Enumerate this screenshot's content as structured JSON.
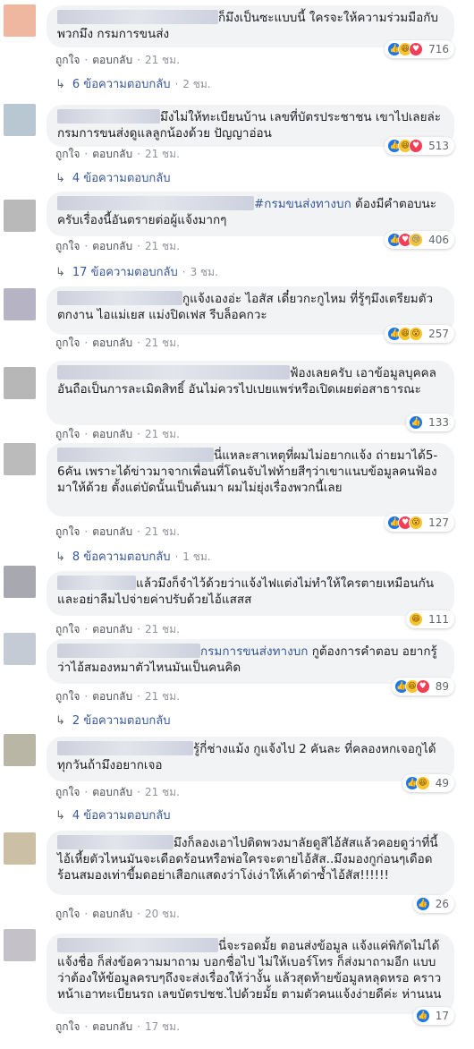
{
  "colors": {
    "bubble": "#f2f3f5",
    "link": "#385898",
    "meta": "#90949c",
    "like": "#1877f2",
    "love": "#f33e58",
    "haha": "#f7c32e"
  },
  "ui": {
    "like_label": "ถูกใจ",
    "reply_label": "ตอบกลับ",
    "separator": "·"
  },
  "comments": [
    {
      "name_hidden": true,
      "text": "ก็มึงเป็นซะแบบนี้ ใครจะให้ความร่วมมือกับพวกมึง กรมการขนส่ง",
      "reactions": [
        "like-icon",
        "haha-icon",
        "love-icon"
      ],
      "count": "716",
      "time": "21 ชม.",
      "replies": "6 ข้อความตอบกลับ",
      "replies_time": "2 ชม."
    },
    {
      "name_hidden": true,
      "text": "มึงไม่ให้ทะเบียนบ้าน เลขที่บัตรประชาชน เขาไปเลยล่ะ กรมการขนส่งดูแลลูกน้องด้วย ปัญญาอ่อน",
      "reactions": [
        "like-icon",
        "haha-icon",
        "love-icon"
      ],
      "count": "513",
      "time": "21 ชม.",
      "replies": "4 ข้อความตอบกลับ",
      "replies_time": ""
    },
    {
      "name_hidden": true,
      "tag": "#กรมขนส่งทางบก",
      "text": "ต้องมีคำตอบนะครับเรื่องนี้อันตรายต่อผู้แจ้งมากๆ",
      "reactions": [
        "like-icon",
        "love-icon",
        "sad-icon"
      ],
      "count": "406",
      "time": "21 ชม.",
      "replies": "17 ข้อความตอบกลับ",
      "replies_time": "3 ชม."
    },
    {
      "name_hidden": true,
      "text": "กูแจ้งเองอ่ะ ไอสัส เดี๋ยวกะกูไหม ที่รู้ๆมึงเตรียมตัวตกงาน ไอแม่เยส แม่งปิดเฟส รีบล็อคกวะ",
      "reactions": [
        "like-icon",
        "haha-icon",
        "wow-icon"
      ],
      "count": "257",
      "time": "21 ชม.",
      "replies": "",
      "replies_time": ""
    },
    {
      "name_hidden": true,
      "text": "ฟ้องเลยครับ เอาข้อมูลบุคคลอันถือเป็นการละเมิดสิทธิ์ อันไม่ควรไปเปยแพร่หรือเปิดเผยต่อสาธารณะ",
      "reactions": [
        "like-icon"
      ],
      "count": "133",
      "time": "21 ชม.",
      "replies": "",
      "replies_time": ""
    },
    {
      "name_hidden": true,
      "text": "นี่แหละสาเหตุที่ผมไม่อยากแจ้ง ถ่ายมาได้5-6คัน เพราะได้ข่าวมาจากเพื่อนที่โดนจับไฟท้ายสีๆว่าเขาแนบข้อมูลคนฟ้องมาให้ด้วย ตั้งแต่บัดนั้นเป็นต้นมา ผมไม่ยุ่งเรื่องพวกนี้เลย",
      "reactions": [
        "like-icon",
        "love-icon",
        "wow-icon"
      ],
      "count": "127",
      "time": "21 ชม.",
      "replies": "8 ข้อความตอบกลับ",
      "replies_time": "1 ชม."
    },
    {
      "name_hidden": true,
      "text": "แล้วมึงก็จำไว้ด้วยว่าแจ้งไฟแต่งไม่ทำให้ใครตายเหมือนกัน และอย่าลืมไปจ่ายค่าปรับด้วยไอ้แสสส",
      "reactions": [
        "haha-icon"
      ],
      "count": "111",
      "time": "21 ชม.",
      "replies": "",
      "replies_time": ""
    },
    {
      "name_hidden": true,
      "tag": "กรมการขนส่งทางบก",
      "text": "กูต้องการคำตอบ อยากรู้ว่าไอ้สมองหมาตัวไหนมันเป็นคนคิด",
      "reactions": [
        "like-icon",
        "haha-icon",
        "love-icon"
      ],
      "count": "89",
      "time": "21 ชม.",
      "replies": "2 ข้อความตอบกลับ",
      "replies_time": ""
    },
    {
      "name_hidden": true,
      "text": "รู้กี่ช่างแม้ง กูแจ้งไป 2 คันละ ที่คลองหกเจอกูได้ทุกวันถ้ามึงอยากเจอ",
      "reactions": [
        "like-icon",
        "haha-icon"
      ],
      "count": "49",
      "time": "21 ชม.",
      "replies": "4 ข้อความตอบกลับ",
      "replies_time": ""
    },
    {
      "name_hidden": true,
      "text": "มึงก็ลองเอาไปติดพวงมาลัยดูสิไอ้สัสแล้วคอยดูว่าที่นี้ไอ้เหี้ยตัวไหนมันจะเดือดร้อนหรือพ่อใครจะตายไอ้สัส..มึงมองกูก่อนๆเดือดร้อนสมองเท่าขี้มดอย่าเสือกแสดงว่าโง่เง่าให้เค้าด่าซ้ำไอ้สัส!!!!!!",
      "reactions": [
        "like-icon"
      ],
      "count": "26",
      "time": "20 ชม.",
      "replies": "",
      "replies_time": ""
    },
    {
      "name_hidden": true,
      "text": "นี่จะรอดมั้ย ตอนส่งข้อมูล แจ้งแค่พิกัดไม่ได้แจ้งชื่อ ก็ส่งข้อความมาถาม บอกชื่อไป ไม่ให้เบอร์โทร ก็ส่งมาถามอีก แบบว่าต้องให้ข้อมูลครบๆถึงจะส่งเรื่องให้ว่างั้น แล้วสุดท้ายข้อมูลหลุดหรอ คราวหน้าเอาทะเบียนรถ เลขบัตรปชช.ไปด้วยมั้ย ตามตัวคนแจ้งง่ายดีค่ะ ห่านนน",
      "reactions": [
        "like-icon"
      ],
      "count": "17",
      "time": "17 ชม.",
      "replies": "",
      "replies_time": ""
    }
  ]
}
